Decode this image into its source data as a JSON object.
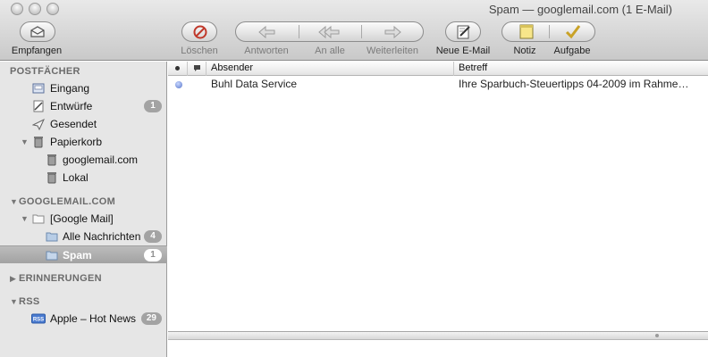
{
  "window": {
    "title": "Spam — googlemail.com (1 E-Mail)"
  },
  "toolbar": {
    "get_mail_label": "Empfangen",
    "delete_label": "Löschen",
    "reply_label": "Antworten",
    "reply_all_label": "An alle",
    "forward_label": "Weiterleiten",
    "new_mail_label": "Neue E-Mail",
    "note_label": "Notiz",
    "todo_label": "Aufgabe"
  },
  "sidebar": {
    "mailboxes_header": "POSTFÄCHER",
    "inbox": {
      "label": "Eingang"
    },
    "drafts": {
      "label": "Entwürfe",
      "count": "1"
    },
    "sent": {
      "label": "Gesendet"
    },
    "trash": {
      "label": "Papierkorb"
    },
    "trash_google": {
      "label": "googlemail.com"
    },
    "trash_local": {
      "label": "Lokal"
    },
    "account_header": "GOOGLEMAIL.COM",
    "google_mail_folder": {
      "label": "[Google Mail]"
    },
    "all_mail": {
      "label": "Alle Nachrichten",
      "count": "4"
    },
    "spam": {
      "label": "Spam",
      "count": "1"
    },
    "reminders_header": "ERINNERUNGEN",
    "rss_header": "RSS",
    "rss_badge": "RSS",
    "rss_feed": {
      "label": "Apple – Hot News",
      "count": "29"
    }
  },
  "message_list": {
    "columns": {
      "sender": "Absender",
      "subject": "Betreff"
    },
    "rows": [
      {
        "sender": "Buhl Data Service",
        "subject": "Ihre Sparbuch-Steuertipps 04-2009 im Rahme…",
        "unread": true
      }
    ]
  }
}
